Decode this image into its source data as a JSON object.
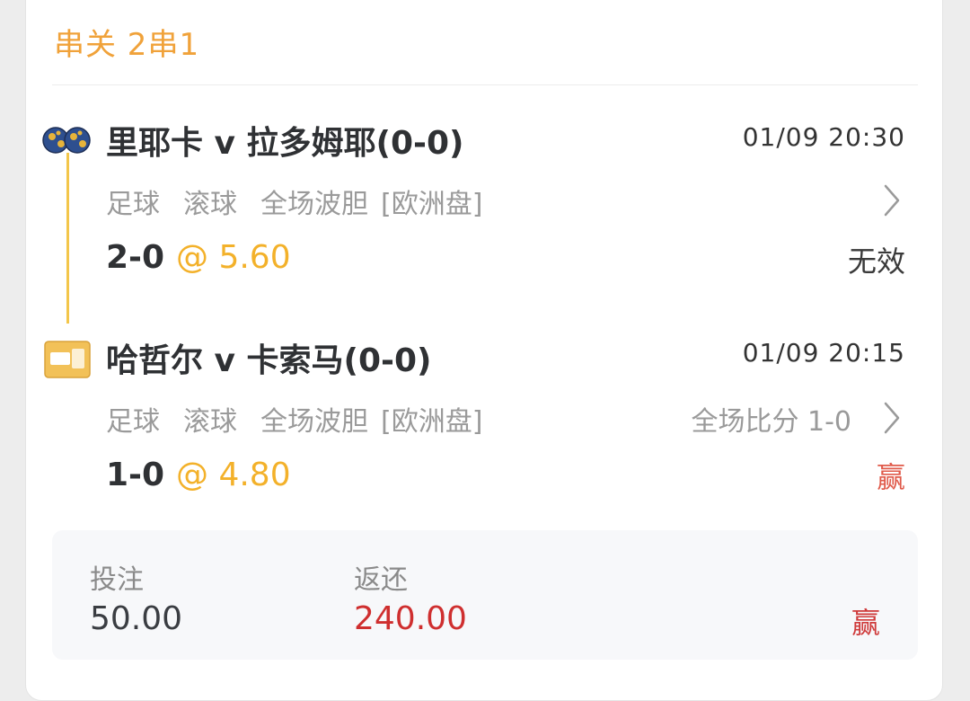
{
  "header": {
    "title": "串关 2串1"
  },
  "matches": [
    {
      "title": "里耶卡 v 拉多姆耶(0-0)",
      "time": "01/09 20:30",
      "sport": "足球",
      "type": "滚球",
      "market": "全场波胆",
      "handicap": "[欧洲盘]",
      "final_score": "",
      "pick": "2-0",
      "odds": "@ 5.60",
      "status": "无效",
      "icon": "soccer-balls-icon"
    },
    {
      "title": "哈哲尔 v 卡索马(0-0)",
      "time": "01/09 20:15",
      "sport": "足球",
      "type": "滚球",
      "market": "全场波胆",
      "handicap": "[欧洲盘]",
      "final_score": "全场比分 1-0",
      "pick": "1-0",
      "odds": "@ 4.80",
      "status": "赢",
      "icon": "league-badge-icon"
    }
  ],
  "summary": {
    "stake_label": "投注",
    "stake_value": "50.00",
    "return_label": "返还",
    "return_value": "240.00",
    "result": "赢"
  },
  "colors": {
    "accent_orange": "#f0a23a",
    "odds_yellow": "#f3b12a",
    "win_red": "#e05a4a",
    "return_red": "#cf2f2f"
  }
}
